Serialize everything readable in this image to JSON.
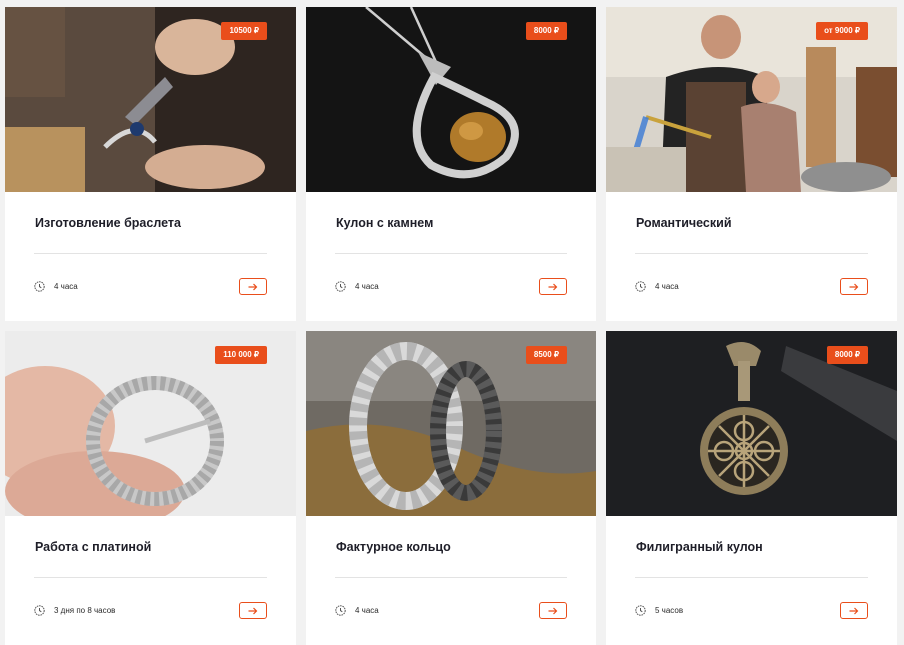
{
  "currency_color": "#e94e1b",
  "cards": [
    {
      "title": "Изготовление браслета",
      "price": "10500 ₽",
      "duration": "4 часа",
      "image": "hands-bending-bracelet-with-pliers-photo"
    },
    {
      "title": "Кулон с камнем",
      "price": "8000 ₽",
      "duration": "4 часа",
      "image": "silver-pendant-with-amber-stone-photo"
    },
    {
      "title": "Романтический",
      "price": "от 9000 ₽",
      "duration": "4 часа",
      "image": "couple-in-workshop-with-torch-photo"
    },
    {
      "title": "Работа с платиной",
      "price": "110 000 ₽",
      "duration": "3 дня по 8 часов",
      "image": "silver-crown-setting-ring-photo"
    },
    {
      "title": "Фактурное кольцо",
      "price": "8500 ₽",
      "duration": "4 часа",
      "image": "hammered-textured-rings-on-stone-photo"
    },
    {
      "title": "Филигранный кулон",
      "price": "8000 ₽",
      "duration": "5 часов",
      "image": "filigree-round-pendant-photo"
    }
  ]
}
